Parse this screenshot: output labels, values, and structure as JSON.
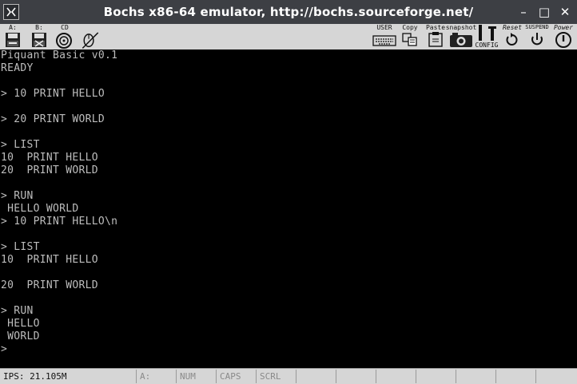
{
  "window": {
    "title": "Bochs x86-64 emulator, http://bochs.sourceforge.net/",
    "app_icon": "bochs-logo-icon",
    "controls": {
      "minimize": "–",
      "maximize": "□",
      "close": "✕"
    }
  },
  "toolbar": {
    "floppy_a_label": "A:",
    "floppy_b_label": "B:",
    "cdrom_label": "CD",
    "user_label": "USER",
    "copy_label": "Copy",
    "paste_label": "Paste",
    "snapshot_label": "snapshot",
    "config_label": "CONFIG",
    "reset_label": "Reset",
    "suspend_label": "SUSPEND",
    "power_label": "Power"
  },
  "console": {
    "lines": [
      "Piquant Basic v0.1",
      "READY",
      "",
      "> 10 PRINT HELLO",
      "",
      "> 20 PRINT WORLD",
      "",
      "> LIST",
      "10  PRINT HELLO",
      "20  PRINT WORLD",
      "",
      "> RUN",
      " HELLO WORLD",
      "> 10 PRINT HELLO\\n",
      "",
      "> LIST",
      "10  PRINT HELLO",
      "",
      "20  PRINT WORLD",
      "",
      "> RUN",
      " HELLO",
      " WORLD",
      ">"
    ]
  },
  "statusbar": {
    "ips": "IPS: 21.105M",
    "drive": "A:",
    "num": "NUM",
    "caps": "CAPS",
    "scrl": "SCRL"
  },
  "colors": {
    "titlebar_bg": "#3d3f44",
    "toolbar_bg": "#d6d6d6",
    "screen_bg": "#000000",
    "screen_text": "#bdbdbd",
    "status_inactive_text": "#8a8a8a"
  }
}
